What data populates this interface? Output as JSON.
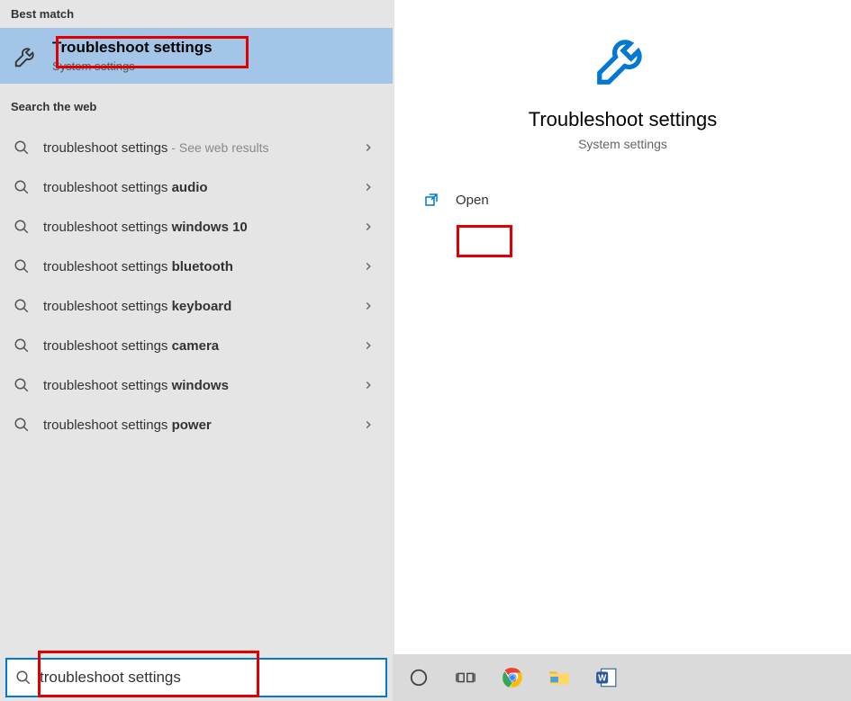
{
  "sections": {
    "best_match_label": "Best match",
    "search_web_label": "Search the web"
  },
  "best_match": {
    "title": "Troubleshoot settings",
    "subtitle": "System settings"
  },
  "web_results": [
    {
      "prefix": "troubleshoot settings",
      "bold": "",
      "suffix": " - See web results"
    },
    {
      "prefix": "troubleshoot settings ",
      "bold": "audio",
      "suffix": ""
    },
    {
      "prefix": "troubleshoot settings ",
      "bold": "windows 10",
      "suffix": ""
    },
    {
      "prefix": "troubleshoot settings ",
      "bold": "bluetooth",
      "suffix": ""
    },
    {
      "prefix": "troubleshoot settings ",
      "bold": "keyboard",
      "suffix": ""
    },
    {
      "prefix": "troubleshoot settings ",
      "bold": "camera",
      "suffix": ""
    },
    {
      "prefix": "troubleshoot settings ",
      "bold": "windows",
      "suffix": ""
    },
    {
      "prefix": "troubleshoot settings ",
      "bold": "power",
      "suffix": ""
    }
  ],
  "detail": {
    "title": "Troubleshoot settings",
    "subtitle": "System settings",
    "open_label": "Open"
  },
  "search": {
    "value": "troubleshoot settings"
  }
}
